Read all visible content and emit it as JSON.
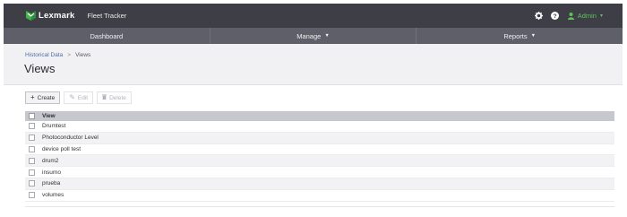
{
  "header": {
    "brand": "Lexmark",
    "app_name": "Fleet Tracker",
    "user_label": "Admin"
  },
  "nav": {
    "items": [
      {
        "label": "Dashboard",
        "has_dropdown": false
      },
      {
        "label": "Manage",
        "has_dropdown": true
      },
      {
        "label": "Reports",
        "has_dropdown": true
      }
    ]
  },
  "breadcrumb": {
    "parent": "Historical Data",
    "separator": ">",
    "current": "Views"
  },
  "page": {
    "title": "Views"
  },
  "toolbar": {
    "create_label": "Create",
    "edit_label": "Edit",
    "delete_label": "Delete"
  },
  "table": {
    "column_header": "View",
    "rows": [
      "Drumtest",
      "Photoconductor Level",
      "device poll test",
      "drum2",
      "insumo",
      "prueba",
      "volumes"
    ]
  },
  "colors": {
    "topbar": "#3e3e46",
    "navbar": "#5e5f68",
    "accent_green": "#5ec15a",
    "link_blue": "#4a6fa5"
  }
}
